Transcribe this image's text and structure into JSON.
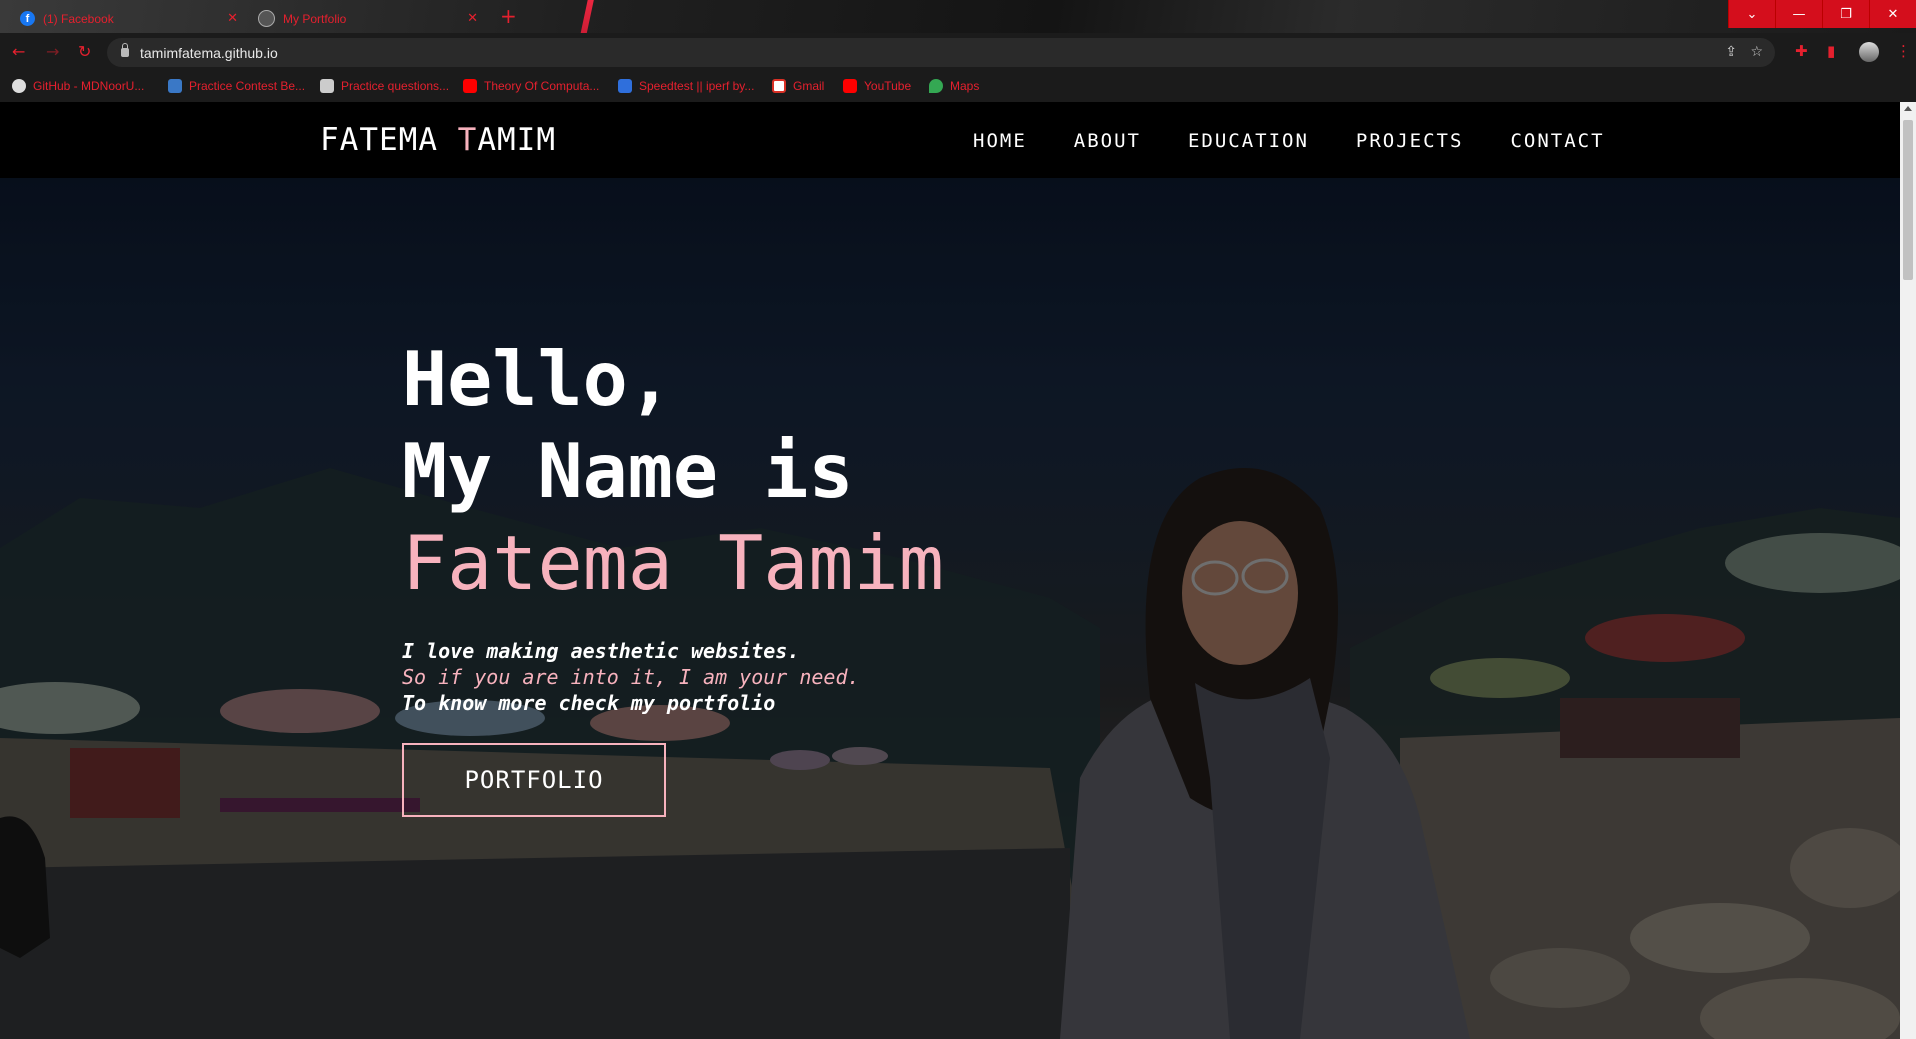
{
  "browser": {
    "tabs": [
      {
        "title": "(1) Facebook",
        "icon": "facebook-icon"
      },
      {
        "title": "My Portfolio",
        "icon": "globe-icon"
      }
    ],
    "url": "tamimfatema.github.io",
    "bookmarks": [
      {
        "label": "GitHub - MDNoorU...",
        "icon": "github-icon"
      },
      {
        "label": "Practice Contest Be...",
        "icon": "vjudge-icon"
      },
      {
        "label": "Practice questions...",
        "icon": "leetcode-icon"
      },
      {
        "label": "Theory Of Computa...",
        "icon": "youtube-icon"
      },
      {
        "label": "Speedtest || iperf by...",
        "icon": "speedtest-icon"
      },
      {
        "label": "Gmail",
        "icon": "gmail-icon"
      },
      {
        "label": "YouTube",
        "icon": "youtube-icon"
      },
      {
        "label": "Maps",
        "icon": "maps-icon"
      }
    ],
    "accent_color": "#e5202e"
  },
  "site": {
    "logo_first": "FATEMA ",
    "logo_accent": "T",
    "logo_rest": "AMIM",
    "nav": [
      "HOME",
      "ABOUT",
      "EDUCATION",
      "PROJECTS",
      "CONTACT"
    ],
    "hero": {
      "line1": "Hello,",
      "line2": "My Name is",
      "name": "Fatema Tamim",
      "tagline1": "I love making aesthetic websites.",
      "tagline2": "So if you are into it, I am your need.",
      "tagline3": "To know more check my portfolio",
      "button": "PORTFOLIO"
    },
    "accent_color": "#f7b2bd"
  }
}
